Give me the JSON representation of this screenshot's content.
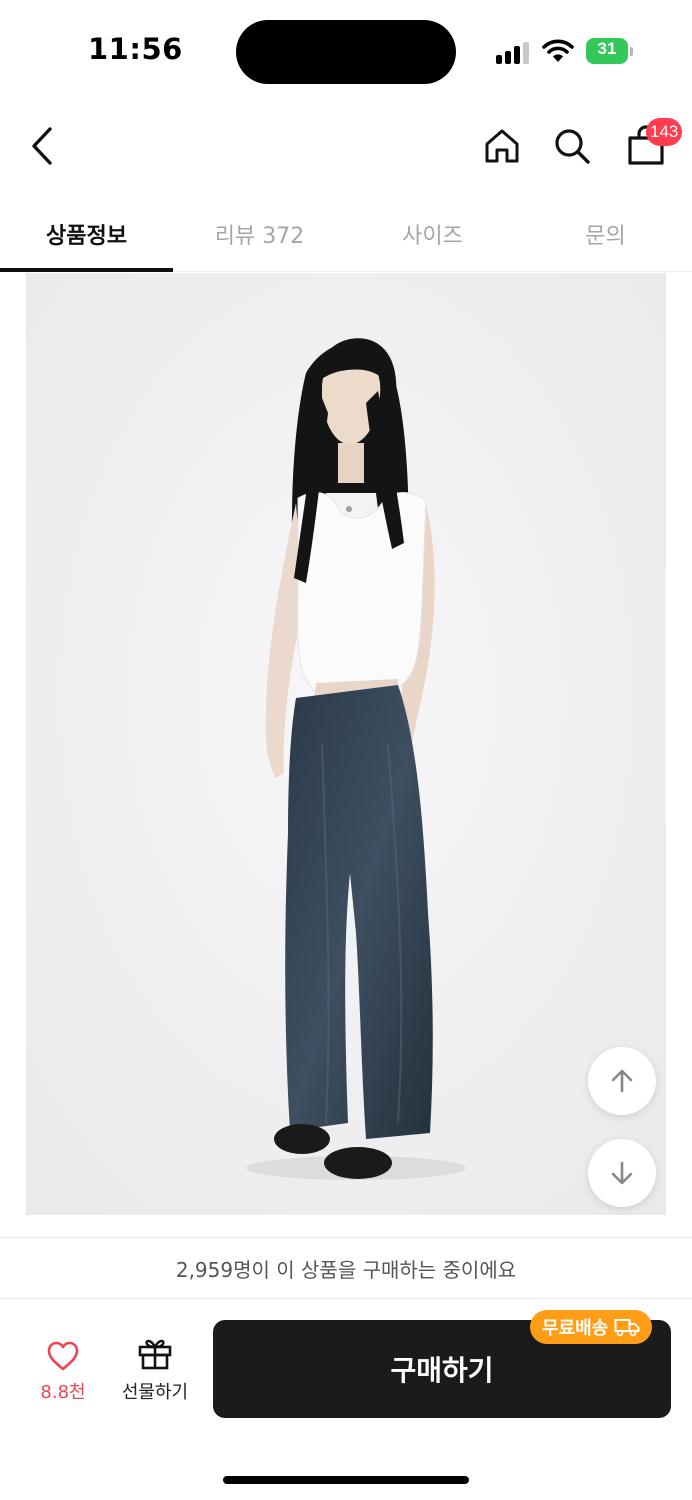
{
  "status_bar": {
    "time": "11:56",
    "battery": "31",
    "icons": [
      "signal-icon",
      "wifi-icon",
      "battery-icon"
    ]
  },
  "header": {
    "icons": [
      "back-arrow-icon",
      "home-icon",
      "search-icon",
      "shopping-bag-icon"
    ],
    "cart_badge": "143"
  },
  "tabs": [
    {
      "label": "상품정보",
      "active": true
    },
    {
      "label": "리뷰 372",
      "active": false
    },
    {
      "label": "사이즈",
      "active": false
    },
    {
      "label": "문의",
      "active": false
    }
  ],
  "scroll_buttons": [
    "arrow-up-icon",
    "arrow-down-icon"
  ],
  "buyer_banner": "2,959명이 이 상품을 구매하는 중이에요",
  "bottom_bar": {
    "like_count": "8.8천",
    "gift_label": "선물하기",
    "buy_label": "구매하기",
    "shipping_badge": "무료배송"
  },
  "colors": {
    "accent_red": "#f04452",
    "badge_red": "#ff3b4e",
    "shipping_orange": "#ff9d16",
    "buy_button": "#1b1b1b",
    "battery_green": "#34c759"
  }
}
